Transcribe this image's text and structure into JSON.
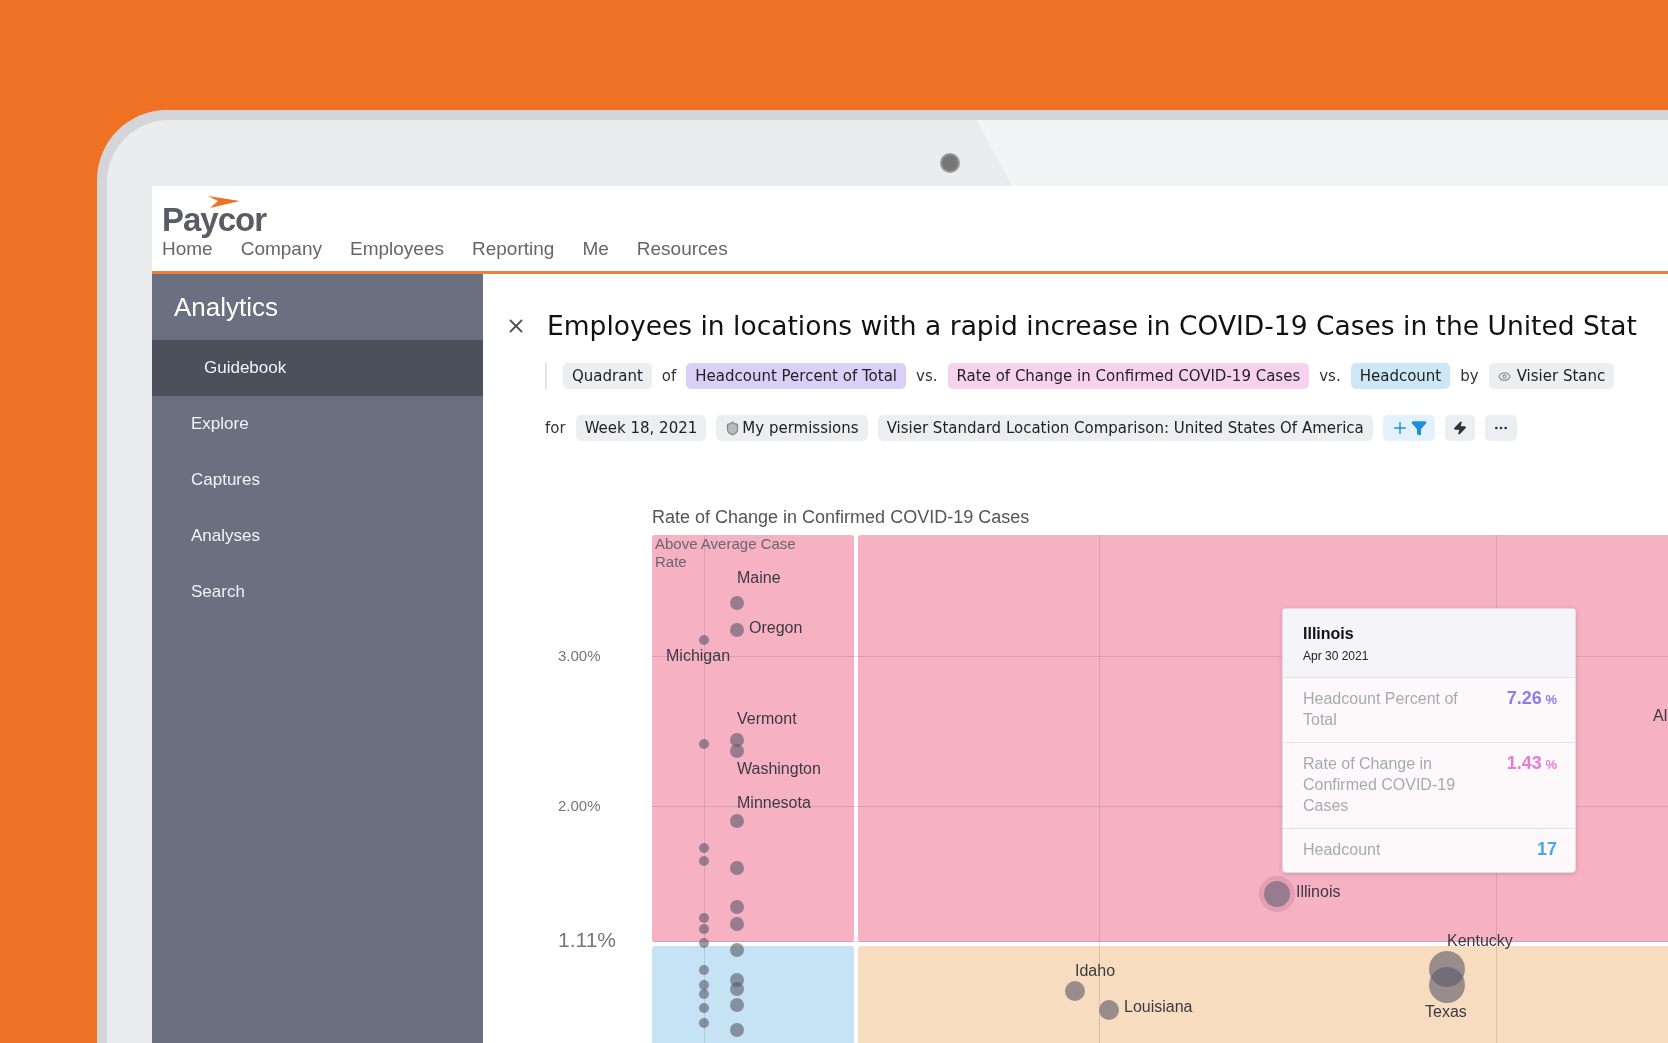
{
  "brand": {
    "name": "Paycor"
  },
  "nav": [
    {
      "label": "Home"
    },
    {
      "label": "Company"
    },
    {
      "label": "Employees"
    },
    {
      "label": "Reporting"
    },
    {
      "label": "Me"
    },
    {
      "label": "Resources"
    }
  ],
  "sidebar": {
    "title": "Analytics",
    "items": [
      {
        "label": "Guidebook",
        "selected": true
      },
      {
        "label": "Explore",
        "selected": false
      },
      {
        "label": "Captures",
        "selected": false
      },
      {
        "label": "Analyses",
        "selected": false
      },
      {
        "label": "Search",
        "selected": false
      }
    ]
  },
  "title": "Employees in locations with a rapid increase in COVID-19 Cases in the United Stat",
  "query_row_1": [
    {
      "kind": "pill",
      "text": "Quadrant",
      "color": "#eceef2"
    },
    {
      "kind": "word",
      "text": "of"
    },
    {
      "kind": "pill",
      "text": "Headcount Percent of Total",
      "color": "#d8d0f6"
    },
    {
      "kind": "word",
      "text": "vs."
    },
    {
      "kind": "pill",
      "text": "Rate of Change in Confirmed COVID-19 Cases",
      "color": "#f6d2ef"
    },
    {
      "kind": "word",
      "text": "vs."
    },
    {
      "kind": "pill",
      "text": "Headcount",
      "color": "#cce8f7"
    },
    {
      "kind": "word",
      "text": "by"
    },
    {
      "kind": "eye-pill",
      "text": "Visier Stanc",
      "color": "#eceef2"
    }
  ],
  "query_row_2": [
    {
      "kind": "word",
      "text": "for"
    },
    {
      "kind": "pill",
      "text": "Week 18, 2021",
      "color": "#eceef2"
    },
    {
      "kind": "shield-pill",
      "text": "My permissions",
      "color": "#eceef2"
    },
    {
      "kind": "pill",
      "text": "Visier Standard Location Comparison: United States Of America",
      "color": "#eceef2"
    },
    {
      "kind": "filter-button"
    },
    {
      "kind": "bolt-button"
    },
    {
      "kind": "more-button"
    }
  ],
  "chart": {
    "axis_title": "Rate of Change in Confirmed COVID-19 Cases",
    "y_ticks": [
      {
        "label": "3.00%",
        "major": false
      },
      {
        "label": "2.00%",
        "major": false
      },
      {
        "label": "1.11%",
        "major": true
      }
    ],
    "quadrant_label": "Above Average Case Rate",
    "point_labels": [
      {
        "text": "Maine"
      },
      {
        "text": "Oregon"
      },
      {
        "text": "Michigan"
      },
      {
        "text": "Vermont"
      },
      {
        "text": "Washington"
      },
      {
        "text": "Minnesota"
      },
      {
        "text": "Illinois"
      },
      {
        "text": "Kentucky"
      },
      {
        "text": "Idaho"
      },
      {
        "text": "Louisiana"
      },
      {
        "text": "Texas"
      },
      {
        "text": "Al"
      }
    ],
    "tooltip": {
      "title": "Illinois",
      "date": "Apr 30 2021",
      "rows": [
        {
          "label": "Headcount Percent of Total",
          "value": "7.26",
          "unit": "%",
          "color": "#8b7cf0"
        },
        {
          "label": "Rate of Change in Confirmed COVID-19 Cases",
          "value": "1.43",
          "unit": "%",
          "color": "#e87ad8"
        },
        {
          "label": "Headcount",
          "value": "17",
          "color": "#4aa8e6"
        }
      ]
    }
  }
}
